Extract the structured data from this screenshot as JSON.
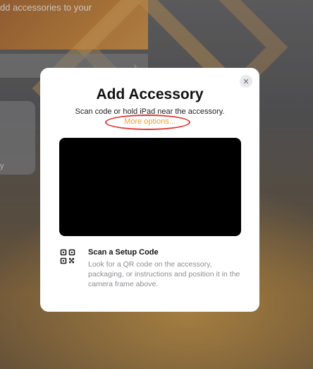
{
  "background": {
    "banner_text": "dd accessories to your",
    "tile_text": "y",
    "row_chevron": "›"
  },
  "modal": {
    "close_glyph": "✕",
    "title": "Add Accessory",
    "subtitle": "Scan code or hold iPad near the accessory.",
    "more_options": "More options...",
    "scan_title": "Scan a Setup Code",
    "scan_description": "Look for a QR code on the accessory, packaging, or instructions and position it in the camera frame above."
  },
  "colors": {
    "accent_orange": "#f0a030",
    "annotation_red": "#e2322b",
    "camera_black": "#000000"
  },
  "icons": [
    "close-icon",
    "qr-code-icon",
    "chevron-right-icon"
  ]
}
